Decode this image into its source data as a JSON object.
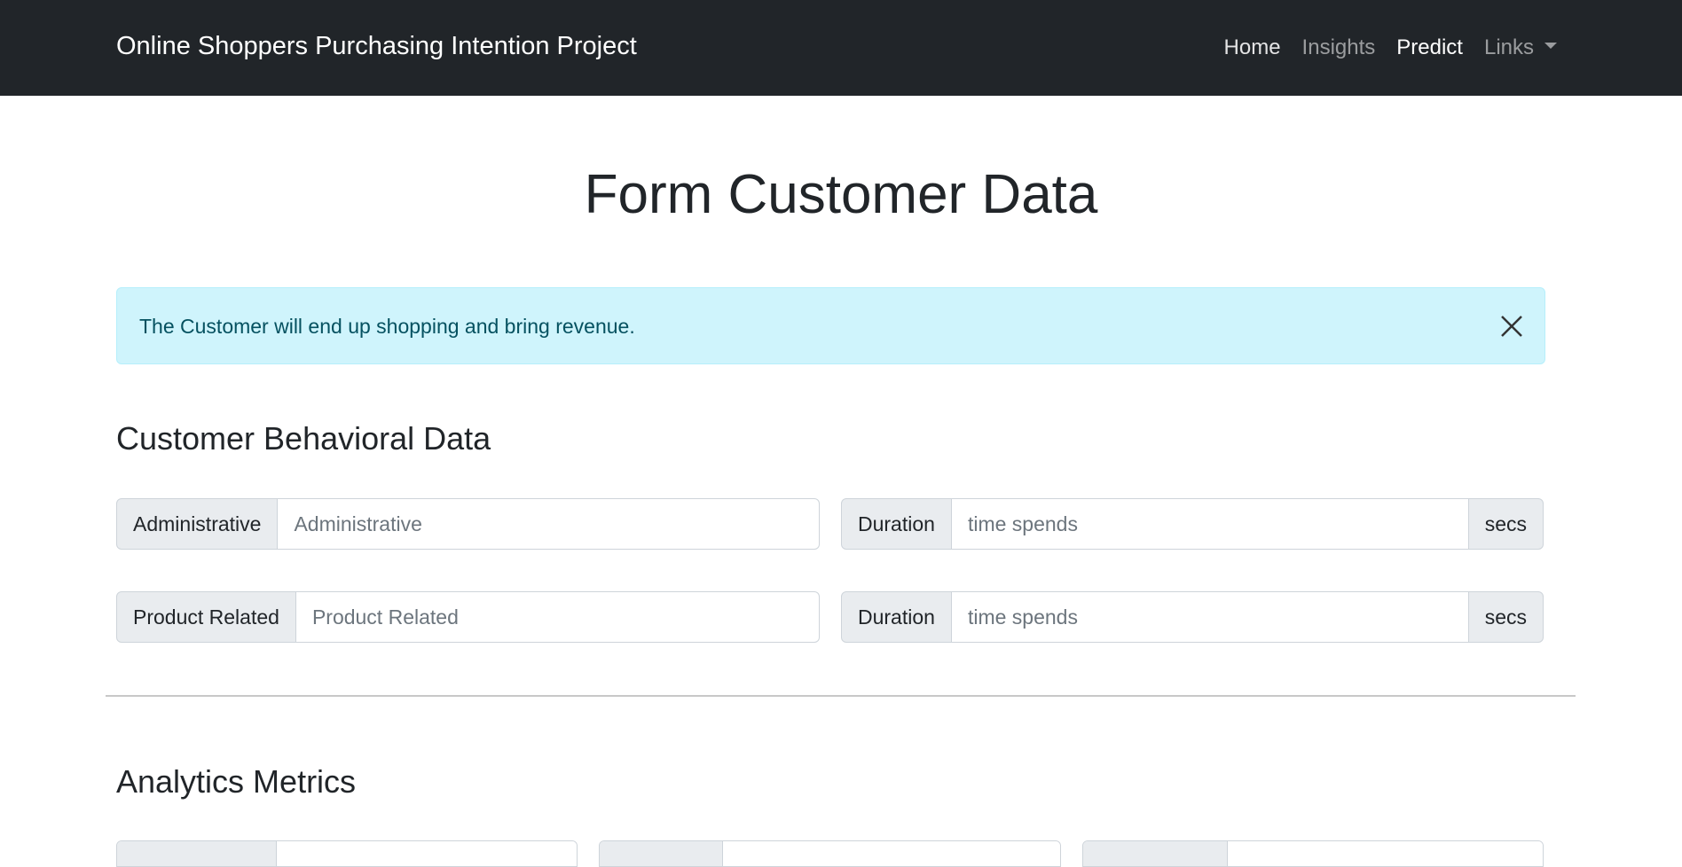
{
  "navbar": {
    "brand": "Online Shoppers Purchasing Intention Project",
    "links": [
      {
        "label": "Home"
      },
      {
        "label": "Insights"
      },
      {
        "label": "Predict"
      },
      {
        "label": "Links"
      }
    ]
  },
  "page": {
    "title": "Form Customer Data"
  },
  "alert": {
    "message": "The Customer will end up shopping and bring revenue.",
    "close_icon": "close-icon",
    "color": "#cff4fc"
  },
  "behavioral": {
    "title": "Customer Behavioral Data",
    "administrative": {
      "label": "Administrative",
      "placeholder": "Administrative"
    },
    "administrative_duration": {
      "label": "Duration",
      "placeholder": "time spends",
      "suffix": "secs"
    },
    "product_related": {
      "label": "Product Related",
      "placeholder": "Product Related"
    },
    "product_related_duration": {
      "label": "Duration",
      "placeholder": "time spends",
      "suffix": "secs"
    }
  },
  "analytics": {
    "title": "Analytics Metrics"
  },
  "colors": {
    "navbar": "#212529",
    "accent": "#cff4fc",
    "addon": "#e9ecef"
  }
}
